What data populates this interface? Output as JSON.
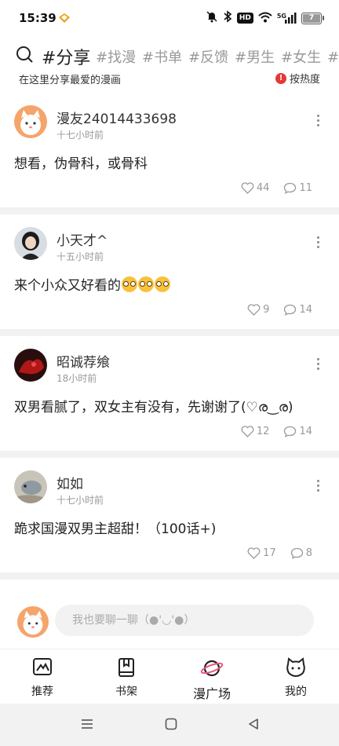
{
  "status_bar": {
    "time": "15:39",
    "network_badge": "HD",
    "signal_label": "5G",
    "battery_level": "7"
  },
  "topics": {
    "tabs": [
      {
        "label": "#分享",
        "active": true
      },
      {
        "label": "#找漫"
      },
      {
        "label": "#书单"
      },
      {
        "label": "#反馈"
      },
      {
        "label": "#男生"
      },
      {
        "label": "#女生"
      },
      {
        "label": "#百"
      }
    ],
    "subtitle": "在这里分享最爱的漫画",
    "sort_label": "按热度",
    "sort_icon_glyph": "!"
  },
  "posts": [
    {
      "username": "漫友24014433698",
      "time": "十七小时前",
      "content": "想看，伪骨科，或骨科",
      "likes": "44",
      "comments": "11"
    },
    {
      "username": "小天才^",
      "time": "十五小时前",
      "content": "来个小众又好看的",
      "emoji_count": 3,
      "likes": "9",
      "comments": "14"
    },
    {
      "username": "昭诚荐飨",
      "time": "18小时前",
      "content": "双男看腻了，双女主有没有，先谢谢了(♡ര‿ര)",
      "likes": "12",
      "comments": "14"
    },
    {
      "username": "如如",
      "time": "十七小时前",
      "content": "跪求国漫双男主超甜！（100话+)",
      "likes": "17",
      "comments": "8"
    }
  ],
  "comment_input": {
    "placeholder": "我也要聊一聊（●'◡'●）"
  },
  "bottom_nav": [
    {
      "label": "推荐",
      "icon": "recommend-icon"
    },
    {
      "label": "书架",
      "icon": "bookshelf-icon"
    },
    {
      "label": "漫广场",
      "icon": "planet-icon",
      "active": true
    },
    {
      "label": "我的",
      "icon": "cat-face-icon"
    }
  ],
  "colors": {
    "accent": "#e53935",
    "divider": "#f2f2f2",
    "muted": "#999999"
  }
}
